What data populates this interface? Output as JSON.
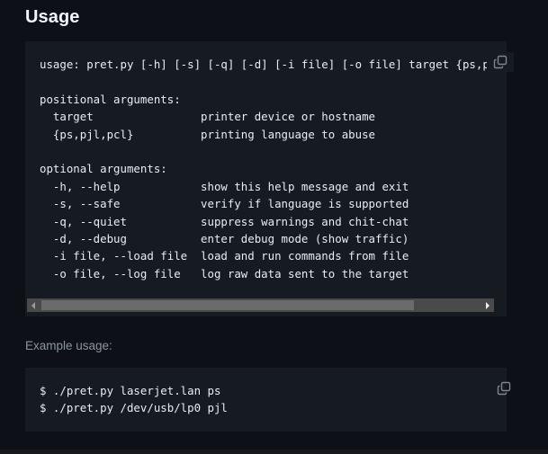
{
  "section": {
    "title": "Usage"
  },
  "usage_block": {
    "lines": [
      "usage: pret.py [-h] [-s] [-q] [-d] [-i file] [-o file] target {ps,pjl,pcl}",
      "",
      "positional arguments:",
      "  target                printer device or hostname",
      "  {ps,pjl,pcl}          printing language to abuse",
      "",
      "optional arguments:",
      "  -h, --help            show this help message and exit",
      "  -s, --safe            verify if language is supported",
      "  -q, --quiet           suppress warnings and chit-chat",
      "  -d, --debug           enter debug mode (show traffic)",
      "  -i file, --load file  load and run commands from file",
      "  -o file, --log file   log raw data sent to the target"
    ],
    "copy_icon": "copy-icon",
    "scrollbar": {
      "visible_fraction": 0.85,
      "scroll_position": 0
    }
  },
  "example": {
    "heading": "Example usage:",
    "lines": [
      "$ ./pret.py laserjet.lan ps",
      "$ ./pret.py /dev/usb/lp0 pjl"
    ],
    "copy_icon": "copy-icon"
  },
  "colors": {
    "page_bg": "#0d1117",
    "code_bg": "#161b22",
    "text": "#e6edf3",
    "muted": "#8b949e",
    "icon": "#7d8590"
  }
}
